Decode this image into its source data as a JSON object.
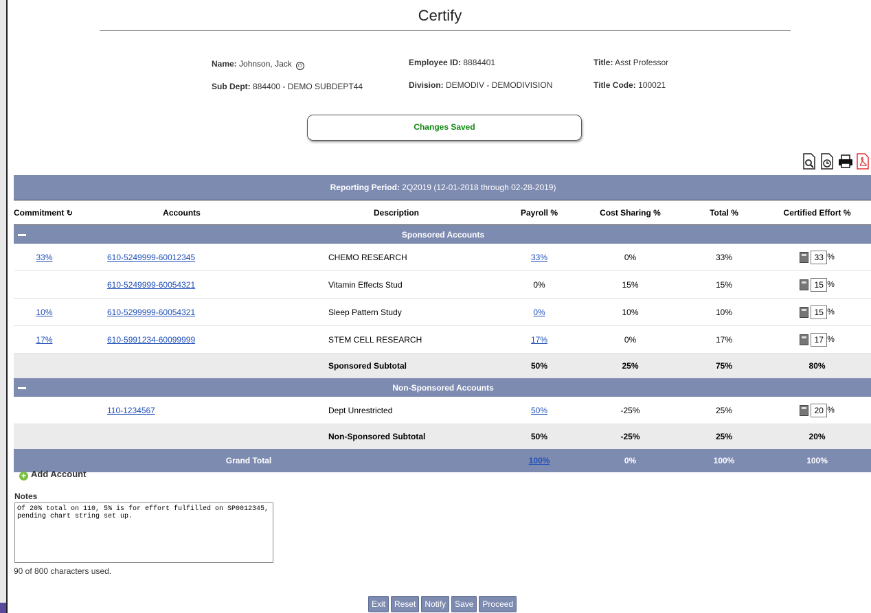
{
  "page": {
    "title": "Certify"
  },
  "employee": {
    "name_label": "Name:",
    "name": "Johnson, Jack",
    "id_label": "Employee ID:",
    "id": "8884401",
    "title_label": "Title:",
    "title": "Asst Professor",
    "subdept_label": "Sub Dept:",
    "subdept": "884400 - DEMO SUBDEPT44",
    "division_label": "Division:",
    "division": "DEMODIV - DEMODIVISION",
    "titlecode_label": "Title Code:",
    "titlecode": "100021"
  },
  "status_message": "Changes Saved",
  "toolbar_icons": [
    "preview-icon",
    "history-icon",
    "print-icon",
    "pdf-icon"
  ],
  "reporting_period": {
    "label": "Reporting Period:",
    "value": "2Q2019 (12-01-2018 through 02-28-2019)"
  },
  "columns": [
    "Commitment",
    "Accounts",
    "Description",
    "Payroll %",
    "Cost Sharing %",
    "Total %",
    "Certified Effort %"
  ],
  "sponsored": {
    "title": "Sponsored Accounts",
    "rows": [
      {
        "commitment": "33%",
        "account": "610-5249999-60012345",
        "description": "CHEMO RESEARCH",
        "payroll": "33%",
        "payroll_link": true,
        "cost_sharing": "0%",
        "total": "33%",
        "effort": "33"
      },
      {
        "commitment": "",
        "account": "610-5249999-60054321",
        "description": "Vitamin Effects Stud",
        "payroll": "0%",
        "payroll_link": false,
        "cost_sharing": "15%",
        "total": "15%",
        "effort": "15"
      },
      {
        "commitment": "10%",
        "account": "610-5299999-60054321",
        "description": "Sleep Pattern Study",
        "payroll": "0%",
        "payroll_link": true,
        "cost_sharing": "10%",
        "total": "10%",
        "effort": "15"
      },
      {
        "commitment": "17%",
        "account": "610-5991234-60099999",
        "description": "STEM CELL RESEARCH",
        "payroll": "17%",
        "payroll_link": true,
        "cost_sharing": "0%",
        "total": "17%",
        "effort": "17"
      }
    ],
    "subtotal": {
      "label": "Sponsored Subtotal",
      "payroll": "50%",
      "cost_sharing": "25%",
      "total": "75%",
      "effort": "80%"
    }
  },
  "nonsponsored": {
    "title": "Non-Sponsored Accounts",
    "rows": [
      {
        "commitment": "",
        "account": "110-1234567",
        "description": "Dept Unrestricted",
        "payroll": "50%",
        "payroll_link": true,
        "cost_sharing": "-25%",
        "total": "25%",
        "effort": "20"
      }
    ],
    "subtotal": {
      "label": "Non-Sponsored Subtotal",
      "payroll": "50%",
      "cost_sharing": "-25%",
      "total": "25%",
      "effort": "20%"
    }
  },
  "grand_total": {
    "label": "Grand Total",
    "payroll": "100%",
    "cost_sharing": "0%",
    "total": "100%",
    "effort": "100%"
  },
  "effort_suffix": "%",
  "add_account": "Add Account",
  "notes": {
    "label": "Notes",
    "value": "Of 20% total on 110, 5% is for effort fulfilled on SP0012345, pending chart string set up.",
    "count": "90 of 800 characters used."
  },
  "buttons": [
    "Exit",
    "Reset",
    "Notify",
    "Save",
    "Proceed"
  ],
  "colors": {
    "bar": "#7e8bb1",
    "link": "#1f4fb8",
    "saved": "#118811"
  }
}
